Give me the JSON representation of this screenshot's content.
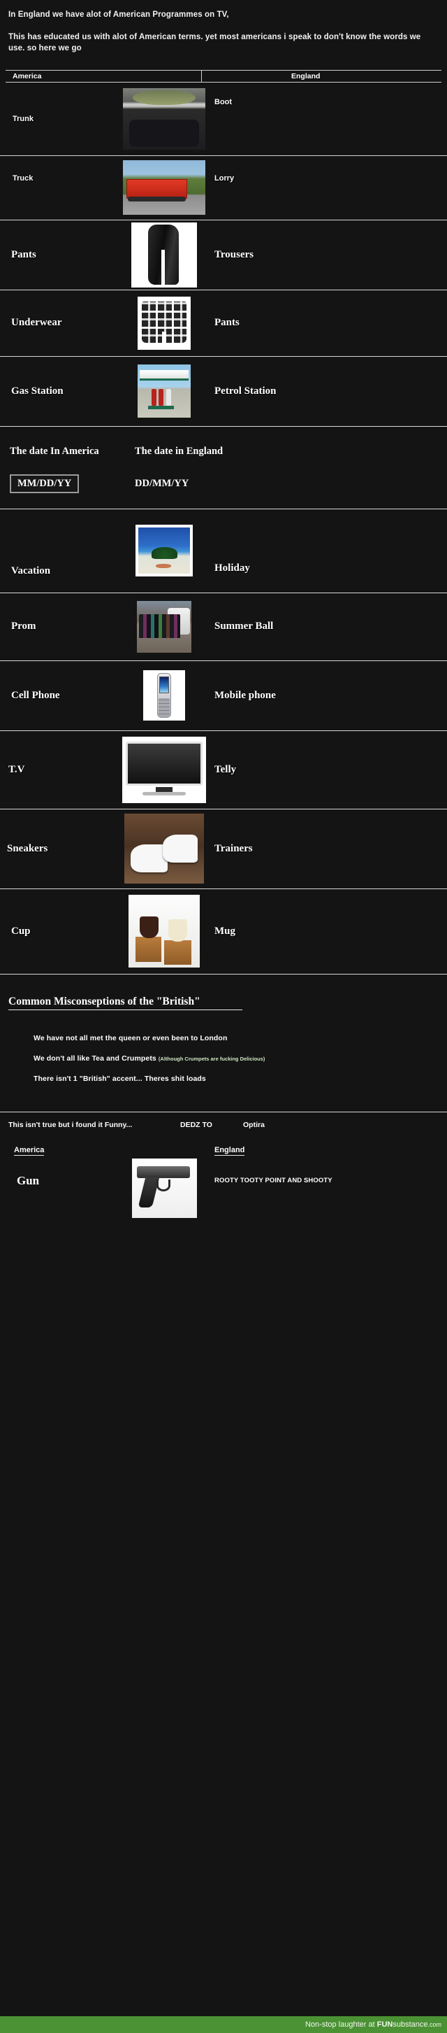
{
  "intro": {
    "line1": "In England we have alot of American Programmes on TV,",
    "line2": "This has educated us with alot of American terms. yet most americans i speak to don't know the words we use. so here we go"
  },
  "table": {
    "header": {
      "left": "America",
      "right": "England"
    },
    "rows": [
      {
        "left": "Trunk",
        "right": "Boot",
        "image": "car-trunk-photo",
        "style": "sans"
      },
      {
        "left": "Truck",
        "right": "Lorry",
        "image": "red-lorry-photo",
        "style": "sans"
      },
      {
        "left": "Pants",
        "right": "Trousers",
        "image": "black-trousers-photo",
        "style": "serif"
      },
      {
        "left": "Underwear",
        "right": "Pants",
        "image": "plaid-boxers-photo",
        "style": "serif"
      },
      {
        "left": "Gas Station",
        "right": "Petrol Station",
        "image": "petrol-station-photo",
        "style": "serif"
      },
      {
        "left": "Vacation",
        "right": "Holiday",
        "image": "tropical-beach-photo",
        "style": "serif"
      },
      {
        "left": "Prom",
        "right": "Summer Ball",
        "image": "prom-group-photo",
        "style": "serif"
      },
      {
        "left": "Cell Phone",
        "right": "Mobile phone",
        "image": "mobile-phone-photo",
        "style": "serif"
      },
      {
        "left": "T.V",
        "right": "Telly",
        "image": "flat-screen-tv-photo",
        "style": "serif"
      },
      {
        "left": "Sneakers",
        "right": "Trainers",
        "image": "white-sneakers-photo",
        "style": "serif"
      },
      {
        "left": "Cup",
        "right": "Mug",
        "image": "coffee-tea-mugs-photo",
        "style": "serif"
      }
    ]
  },
  "date_section": {
    "title_us": "The date In America",
    "title_uk": "The date in England",
    "value_us": "MM/DD/YY",
    "value_uk": "DD/MM/YY"
  },
  "misconceptions": {
    "heading": "Common Misconseptions of the \"British\"",
    "items": [
      {
        "text": "We have not all met the queen or even been to London",
        "note": ""
      },
      {
        "text": "We don't all like Tea and Crumpets",
        "note": "(Although Crumpets are fucking Delicious)"
      },
      {
        "text": "There isn't 1 \"British\" accent... Theres shit loads",
        "note": ""
      }
    ]
  },
  "credits": {
    "disclaimer": "This isn't true but i found it Funny...",
    "dedication_label": "DEDZ TO",
    "dedication_name": "Optira"
  },
  "bonus": {
    "header_left": "America",
    "header_right": "England",
    "left": "Gun",
    "right": "ROOTY TOOTY POINT AND SHOOTY",
    "image": "handgun-photo"
  },
  "footer": {
    "prefix": "Non-stop laughter at ",
    "brand_bold": "FUN",
    "brand_light": "substance",
    "brand_tld": ".com"
  },
  "colors": {
    "background": "#141414",
    "footer_green": "#4a9233",
    "text": "#ffffff",
    "note_green": "#cfe3c2"
  }
}
